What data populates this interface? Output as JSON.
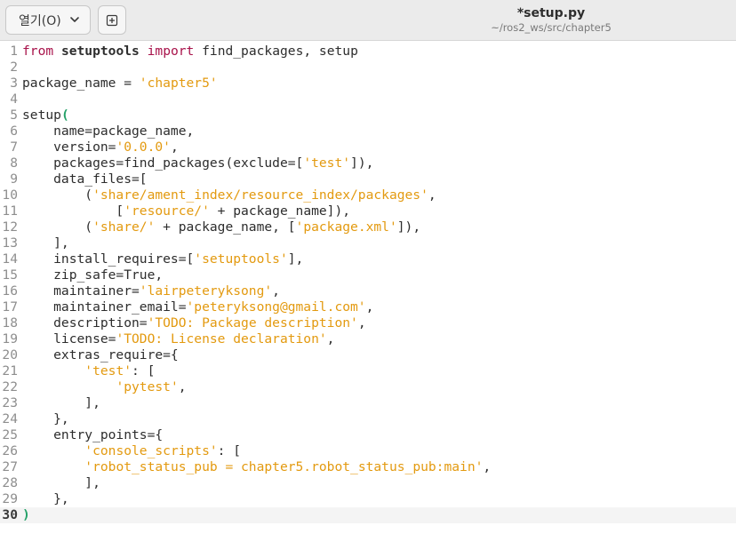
{
  "header": {
    "open_label": "열기(O)",
    "title": "*setup.py",
    "subtitle": "~/ros2_ws/src/chapter5"
  },
  "code_lines": [
    {
      "n": "1",
      "segs": [
        {
          "t": "from",
          "c": "kw"
        },
        {
          "t": " "
        },
        {
          "t": "setuptools",
          "c": "b"
        },
        {
          "t": " "
        },
        {
          "t": "import",
          "c": "kw"
        },
        {
          "t": " find_packages, setup"
        }
      ]
    },
    {
      "n": "2",
      "segs": []
    },
    {
      "n": "3",
      "segs": [
        {
          "t": "package_name = "
        },
        {
          "t": "'chapter5'",
          "c": "s"
        }
      ]
    },
    {
      "n": "4",
      "segs": []
    },
    {
      "n": "5",
      "segs": [
        {
          "t": "setup"
        },
        {
          "t": "(",
          "c": "paren"
        }
      ]
    },
    {
      "n": "6",
      "segs": [
        {
          "t": "    name=package_name,"
        }
      ]
    },
    {
      "n": "7",
      "segs": [
        {
          "t": "    version="
        },
        {
          "t": "'0.0.0'",
          "c": "s"
        },
        {
          "t": ","
        }
      ]
    },
    {
      "n": "8",
      "segs": [
        {
          "t": "    packages=find_packages(exclude=["
        },
        {
          "t": "'test'",
          "c": "s"
        },
        {
          "t": "]),"
        }
      ]
    },
    {
      "n": "9",
      "segs": [
        {
          "t": "    data_files=["
        }
      ]
    },
    {
      "n": "10",
      "segs": [
        {
          "t": "        ("
        },
        {
          "t": "'share/ament_index/resource_index/packages'",
          "c": "s"
        },
        {
          "t": ","
        }
      ]
    },
    {
      "n": "11",
      "segs": [
        {
          "t": "            ["
        },
        {
          "t": "'resource/'",
          "c": "s"
        },
        {
          "t": " + package_name]),"
        }
      ]
    },
    {
      "n": "12",
      "segs": [
        {
          "t": "        ("
        },
        {
          "t": "'share/'",
          "c": "s"
        },
        {
          "t": " + package_name, ["
        },
        {
          "t": "'package.xml'",
          "c": "s"
        },
        {
          "t": "]),"
        }
      ]
    },
    {
      "n": "13",
      "segs": [
        {
          "t": "    ],"
        }
      ]
    },
    {
      "n": "14",
      "segs": [
        {
          "t": "    install_requires=["
        },
        {
          "t": "'setuptools'",
          "c": "s"
        },
        {
          "t": "],"
        }
      ]
    },
    {
      "n": "15",
      "segs": [
        {
          "t": "    zip_safe=True,"
        }
      ]
    },
    {
      "n": "16",
      "segs": [
        {
          "t": "    maintainer="
        },
        {
          "t": "'lairpeteryksong'",
          "c": "s"
        },
        {
          "t": ","
        }
      ]
    },
    {
      "n": "17",
      "segs": [
        {
          "t": "    maintainer_email="
        },
        {
          "t": "'peteryksong@gmail.com'",
          "c": "s"
        },
        {
          "t": ","
        }
      ]
    },
    {
      "n": "18",
      "segs": [
        {
          "t": "    description="
        },
        {
          "t": "'TODO: Package description'",
          "c": "s"
        },
        {
          "t": ","
        }
      ]
    },
    {
      "n": "19",
      "segs": [
        {
          "t": "    license="
        },
        {
          "t": "'TODO: License declaration'",
          "c": "s"
        },
        {
          "t": ","
        }
      ]
    },
    {
      "n": "20",
      "segs": [
        {
          "t": "    extras_require={"
        }
      ]
    },
    {
      "n": "21",
      "segs": [
        {
          "t": "        "
        },
        {
          "t": "'test'",
          "c": "s"
        },
        {
          "t": ": ["
        }
      ]
    },
    {
      "n": "22",
      "segs": [
        {
          "t": "            "
        },
        {
          "t": "'pytest'",
          "c": "s"
        },
        {
          "t": ","
        }
      ]
    },
    {
      "n": "23",
      "segs": [
        {
          "t": "        ],"
        }
      ]
    },
    {
      "n": "24",
      "segs": [
        {
          "t": "    },"
        }
      ]
    },
    {
      "n": "25",
      "segs": [
        {
          "t": "    entry_points={"
        }
      ]
    },
    {
      "n": "26",
      "segs": [
        {
          "t": "        "
        },
        {
          "t": "'console_scripts'",
          "c": "s"
        },
        {
          "t": ": ["
        }
      ]
    },
    {
      "n": "27",
      "segs": [
        {
          "t": "        "
        },
        {
          "t": "'robot_status_pub = chapter5.robot_status_pub:main'",
          "c": "s"
        },
        {
          "t": ","
        }
      ]
    },
    {
      "n": "28",
      "segs": [
        {
          "t": "        ],"
        }
      ]
    },
    {
      "n": "29",
      "segs": [
        {
          "t": "    },"
        }
      ]
    },
    {
      "n": "30",
      "segs": [
        {
          "t": ")",
          "c": "paren"
        }
      ],
      "current": true
    }
  ]
}
